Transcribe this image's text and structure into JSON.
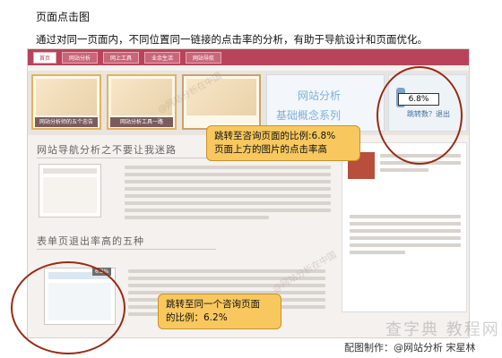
{
  "page": {
    "title": "页面点击图",
    "intro": "通过对同一页面内，不同位置同一链接的点击率的分析，有助于导航设计和页面优化。"
  },
  "site_nav": {
    "tabs": [
      "首页",
      "网站分析",
      "网上工具",
      "业余生活",
      "网站导航"
    ]
  },
  "banner": {
    "card1_caption": "网站分析师的五个忠告",
    "card2_caption": "网站分析工具一路",
    "blue_card_line1": "网站分析",
    "blue_card_line2": "基础概念系列",
    "side_text": "跳转数？退出"
  },
  "rates": {
    "top_rate": "6.8%",
    "bottom_rate": "6.2%"
  },
  "articles": {
    "head1": "网站导航分析之不要让我迷路",
    "head2": "表单页退出率高的五种"
  },
  "callouts": {
    "top_line1": "跳转至咨询页面的比例:6.8%",
    "top_line2": "页面上方的图片的点击率高",
    "bottom_line1": "跳转至同一个咨询页面",
    "bottom_line2": "的比例：6.2%"
  },
  "watermarks": {
    "site": "@网站分析在中国",
    "brand": "查字典 教程网"
  },
  "credit": "配图制作：@网站分析 宋星林"
}
